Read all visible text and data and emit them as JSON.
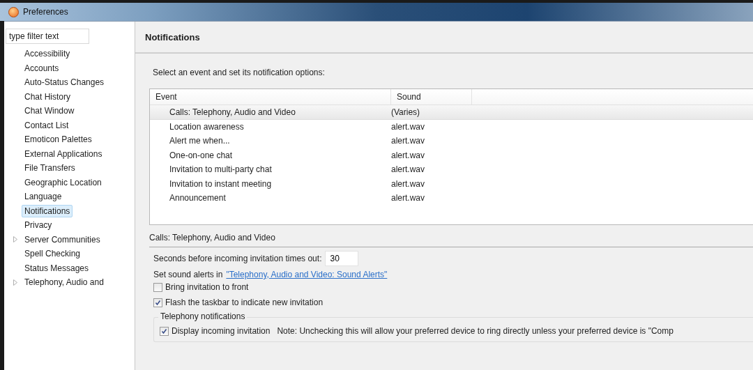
{
  "window": {
    "title": "Preferences"
  },
  "filter": {
    "placeholder": "type filter text"
  },
  "sidebar": {
    "items": [
      {
        "label": "Accessibility",
        "selected": false
      },
      {
        "label": "Accounts",
        "selected": false
      },
      {
        "label": "Auto-Status Changes",
        "selected": false
      },
      {
        "label": "Chat History",
        "selected": false
      },
      {
        "label": "Chat Window",
        "selected": false
      },
      {
        "label": "Contact List",
        "selected": false
      },
      {
        "label": "Emoticon Palettes",
        "selected": false
      },
      {
        "label": "External Applications",
        "selected": false
      },
      {
        "label": "File Transfers",
        "selected": false
      },
      {
        "label": "Geographic Location",
        "selected": false
      },
      {
        "label": "Language",
        "selected": false
      },
      {
        "label": "Notifications",
        "selected": true
      },
      {
        "label": "Privacy",
        "selected": false
      },
      {
        "label": "Server Communities",
        "selected": false,
        "expandable": true
      },
      {
        "label": "Spell Checking",
        "selected": false
      },
      {
        "label": "Status Messages",
        "selected": false
      },
      {
        "label": "Telephony, Audio and",
        "selected": false,
        "expandable": true
      }
    ]
  },
  "page": {
    "title": "Notifications",
    "intro": "Select an event and set its notification options:"
  },
  "table": {
    "columns": [
      "Event",
      "Sound"
    ],
    "rows": [
      {
        "event": "Calls: Telephony, Audio and Video",
        "sound": "(Varies)",
        "selected": true
      },
      {
        "event": "Location awareness",
        "sound": "alert.wav",
        "selected": false
      },
      {
        "event": "Alert me when...",
        "sound": "alert.wav",
        "selected": false
      },
      {
        "event": "One-on-one chat",
        "sound": "alert.wav",
        "selected": false
      },
      {
        "event": "Invitation to multi-party chat",
        "sound": "alert.wav",
        "selected": false
      },
      {
        "event": "Invitation to instant meeting",
        "sound": "alert.wav",
        "selected": false
      },
      {
        "event": "Announcement",
        "sound": "alert.wav",
        "selected": false
      }
    ]
  },
  "details": {
    "title": "Calls: Telephony, Audio and Video",
    "timeout_label": "Seconds before incoming invitation times out:",
    "timeout_value": "30",
    "sound_prefix": "Set sound alerts in",
    "sound_link": "\"Telephony, Audio and Video: Sound Alerts\"",
    "options": [
      {
        "label": "Bring invitation to front",
        "checked": false
      },
      {
        "label": "Flash the taskbar to indicate new invitation",
        "checked": true
      }
    ],
    "group": {
      "title": "Telephony notifications",
      "option": {
        "label": "Display incoming invitation",
        "checked": true
      },
      "note": "Note: Unchecking this will allow your preferred device to ring directly unless your preferred device is \"Comp"
    }
  }
}
